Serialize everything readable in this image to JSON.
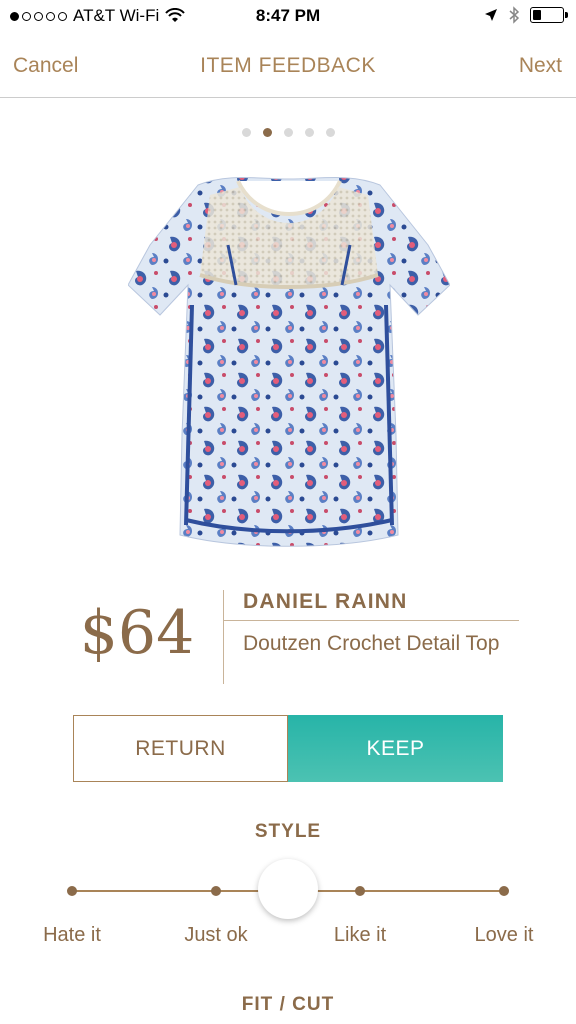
{
  "status_bar": {
    "carrier": "AT&T Wi-Fi",
    "time": "8:47 PM",
    "signal_bars": 1,
    "signal_total": 5,
    "battery_level": 0.3
  },
  "navbar": {
    "cancel_label": "Cancel",
    "title": "ITEM FEEDBACK",
    "next_label": "Next"
  },
  "pager": {
    "total": 5,
    "current": 2
  },
  "product": {
    "price": "$64",
    "brand": "DANIEL RAINN",
    "name": "Doutzen Crochet Detail Top"
  },
  "actions": {
    "return_label": "RETURN",
    "keep_label": "KEEP",
    "selected": "KEEP"
  },
  "style_rating": {
    "title": "STYLE",
    "options": [
      "Hate it",
      "Just ok",
      "Like it",
      "Love it"
    ],
    "value": 0.5
  },
  "fit_section": {
    "title": "FIT / CUT"
  },
  "colors": {
    "brand_brown": "#8b6b4a",
    "accent_tan": "#a98458",
    "keep_teal": "#27b4a8"
  }
}
